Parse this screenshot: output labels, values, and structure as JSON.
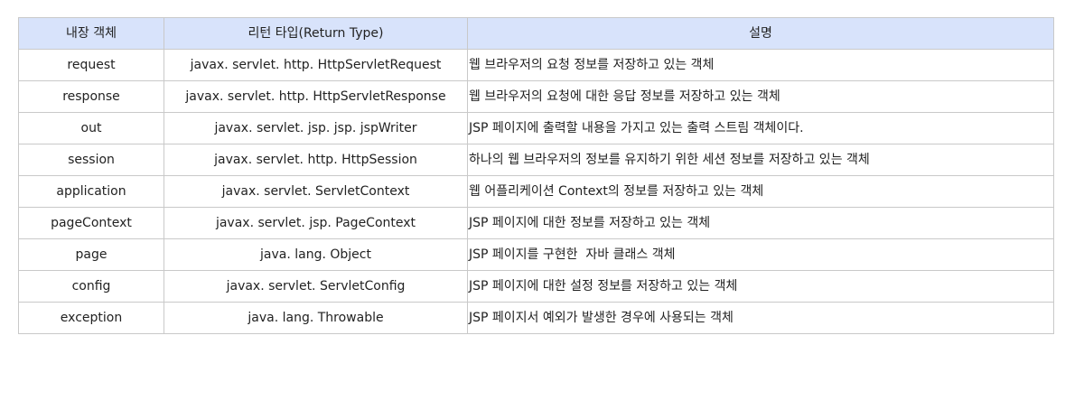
{
  "table": {
    "headers": [
      "내장 객체",
      "리턴 타입(Return Type)",
      "설명"
    ],
    "rows": [
      {
        "object": "request",
        "return_type": "javax. servlet. http. HttpServletRequest",
        "description": "웹 브라우저의 요청 정보를 저장하고 있는 객체"
      },
      {
        "object": "response",
        "return_type": "javax. servlet. http. HttpServletResponse",
        "description": "웹 브라우저의 요청에 대한 응답 정보를 저장하고 있는 객체"
      },
      {
        "object": "out",
        "return_type": "javax. servlet. jsp. jsp. jspWriter",
        "description": "JSP 페이지에 출력할 내용을 가지고 있는 출력 스트림 객체이다."
      },
      {
        "object": "session",
        "return_type": "javax. servlet. http. HttpSession",
        "description": "하나의 웹 브라우저의 정보를 유지하기 위한 세션 정보를 저장하고 있는 객체"
      },
      {
        "object": "application",
        "return_type": "javax. servlet. ServletContext",
        "description": "웹 어플리케이션 Context의 정보를 저장하고 있는 객체"
      },
      {
        "object": "pageContext",
        "return_type": "javax. servlet. jsp. PageContext",
        "description": "JSP 페이지에 대한 정보를 저장하고 있는 객체"
      },
      {
        "object": "page",
        "return_type": "java. lang. Object",
        "description": "JSP 페이지를 구현한  자바 클래스 객체"
      },
      {
        "object": "config",
        "return_type": "javax. servlet. ServletConfig",
        "description": "JSP 페이지에 대한 설정 정보를 저장하고 있는 객체"
      },
      {
        "object": "exception",
        "return_type": "java. lang. Throwable",
        "description": "JSP 페이지서 예외가 발생한 경우에 사용되는 객체"
      }
    ]
  },
  "colors": {
    "header_bg": "#d8e3fb",
    "border": "#c9c9c9"
  }
}
